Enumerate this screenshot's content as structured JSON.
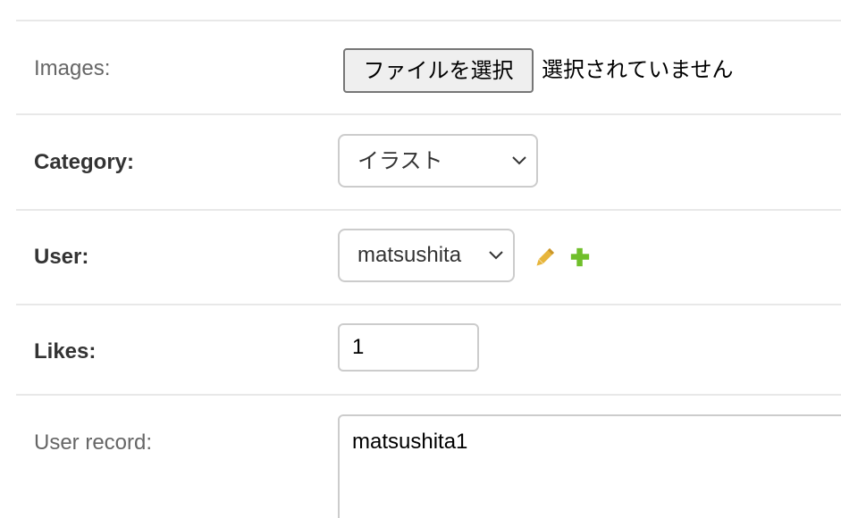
{
  "fields": {
    "images": {
      "label": "Images:",
      "button_label": "ファイルを選択",
      "status_text": "選択されていません"
    },
    "category": {
      "label": "Category:",
      "selected_value": "イラスト"
    },
    "user": {
      "label": "User:",
      "selected_value": "matsushita",
      "edit_icon": "pencil-icon",
      "add_icon": "plus-icon"
    },
    "likes": {
      "label": "Likes:",
      "value": "1"
    },
    "user_record": {
      "label": "User record:",
      "value": "matsushita1"
    }
  },
  "colors": {
    "edit_icon": "#e7b53b",
    "add_icon": "#70bf2b",
    "divider": "#e8e8e8",
    "input_border": "#cccccc"
  }
}
